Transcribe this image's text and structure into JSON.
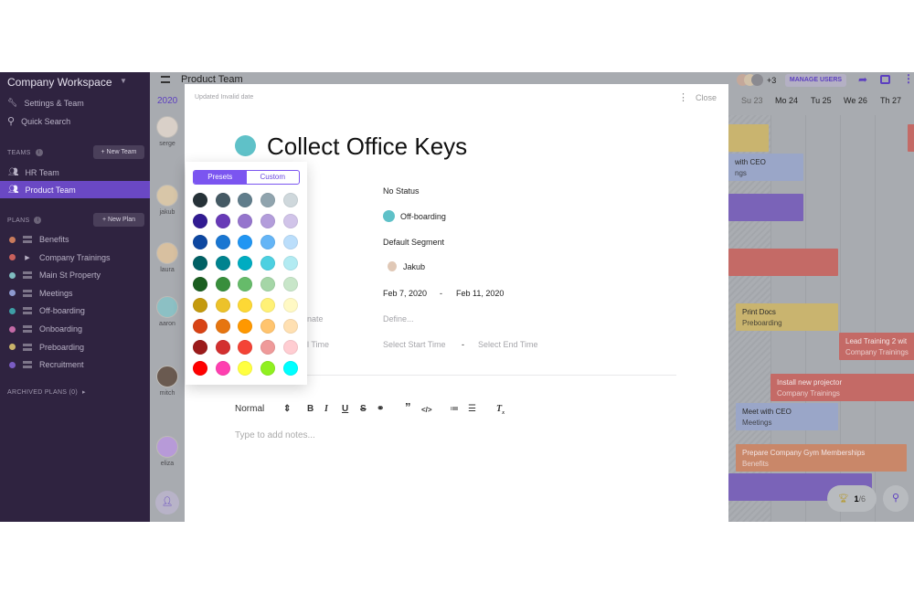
{
  "sidebar": {
    "workspace": "Company Workspace",
    "settings": "Settings & Team",
    "search": "Quick Search",
    "teams_label": "TEAMS",
    "new_team": "+ New Team",
    "teams": [
      {
        "label": "HR Team"
      },
      {
        "label": "Product Team",
        "active": true
      }
    ],
    "plans_label": "PLANS",
    "new_plan": "+ New Plan",
    "plans": [
      {
        "label": "Benefits",
        "color": "#c97b5c"
      },
      {
        "label": "Company Trainings",
        "color": "#c9605c",
        "expandable": true
      },
      {
        "label": "Main St Property",
        "color": "#7fbcc0"
      },
      {
        "label": "Meetings",
        "color": "#8e9ad0"
      },
      {
        "label": "Off-boarding",
        "color": "#3e9ea6"
      },
      {
        "label": "Onboarding",
        "color": "#c46aa6"
      },
      {
        "label": "Preboarding",
        "color": "#c9b36a"
      },
      {
        "label": "Recruitment",
        "color": "#7a5cc4"
      }
    ],
    "archived": "ARCHIVED PLANS (0)"
  },
  "header": {
    "title": "Product Team",
    "extra_users": "+3",
    "manage_users": "MANAGE USERS",
    "year": "2020",
    "days": [
      "Su 23",
      "Mo 24",
      "Tu 25",
      "We 26",
      "Th 27"
    ]
  },
  "people": [
    "serge",
    "jakub",
    "laura",
    "aaron",
    "mitch",
    "eliza"
  ],
  "events": [
    {
      "title": "",
      "sub": "",
      "color": "#c9b46f"
    },
    {
      "title": "with CEO",
      "sub": "ngs",
      "color": "#9aa6c8"
    },
    {
      "title": "",
      "sub": "",
      "color": "#7a63b8"
    },
    {
      "title": "",
      "sub": "",
      "color": "#c46a66"
    },
    {
      "title": "",
      "sub": "",
      "color": "#c46a66"
    },
    {
      "title": "Print Docs",
      "sub": "Preboarding",
      "color": "#c9b46f"
    },
    {
      "title": "Lead Training 2 wit",
      "sub": "Company Trainings",
      "color": "#c46a66"
    },
    {
      "title": "Install new projector",
      "sub": "Company Trainings",
      "color": "#c46a66"
    },
    {
      "title": "Meet with CEO",
      "sub": "Meetings",
      "color": "#9aa6c8"
    },
    {
      "title": "Prepare Company Gym Memberships",
      "sub": "Benefits",
      "color": "#c98769"
    },
    {
      "title": "",
      "sub": "",
      "color": "#7a63b8"
    }
  ],
  "progress": {
    "done": "1",
    "total": "/6"
  },
  "modal": {
    "updated": "Updated Invalid date",
    "close": "Close",
    "title": "Collect Office Keys",
    "color": "#5fc1c8",
    "status": "No Status",
    "plan": "Off-boarding",
    "plan_color": "#5fc1c8",
    "segment": "Default Segment",
    "assignee": "Jakub",
    "start_date": "Feb 7, 2020",
    "end_date": "Feb 11, 2020",
    "dash": "-",
    "estimate_label_partial": "nate",
    "estimate": "Define...",
    "time_label_partial": "l Time",
    "start_time": "Select Start Time",
    "end_time": "Select End Time",
    "format": "Normal",
    "notes_placeholder": "Type to add notes..."
  },
  "color_picker": {
    "tabs": [
      "Presets",
      "Custom"
    ],
    "active_tab": "Presets",
    "swatches": [
      [
        "#263238",
        "#455a64",
        "#607d8b",
        "#90a4ae",
        "#cfd8dc"
      ],
      [
        "#311b92",
        "#673ab7",
        "#9575cd",
        "#b39ddb",
        "#d1c4e9"
      ],
      [
        "#0d47a1",
        "#1976d2",
        "#2196f3",
        "#64b5f6",
        "#bbdefb"
      ],
      [
        "#006064",
        "#00838f",
        "#00acc1",
        "#4dd0e1",
        "#b2ebf2"
      ],
      [
        "#1b5e20",
        "#388e3c",
        "#66bb6a",
        "#a5d6a7",
        "#c8e6c9"
      ],
      [
        "#c49a0e",
        "#ecc22a",
        "#fdd835",
        "#fff176",
        "#fff9c4"
      ],
      [
        "#d84315",
        "#e67510",
        "#ff9800",
        "#ffc46e",
        "#ffe0b2"
      ],
      [
        "#9b1b1b",
        "#d32f2f",
        "#f44336",
        "#ef9a9a",
        "#ffcdd2"
      ],
      [
        "#ff0000",
        "#ff3fb0",
        "#ffff40",
        "#90f020",
        "#00ffff"
      ]
    ]
  }
}
